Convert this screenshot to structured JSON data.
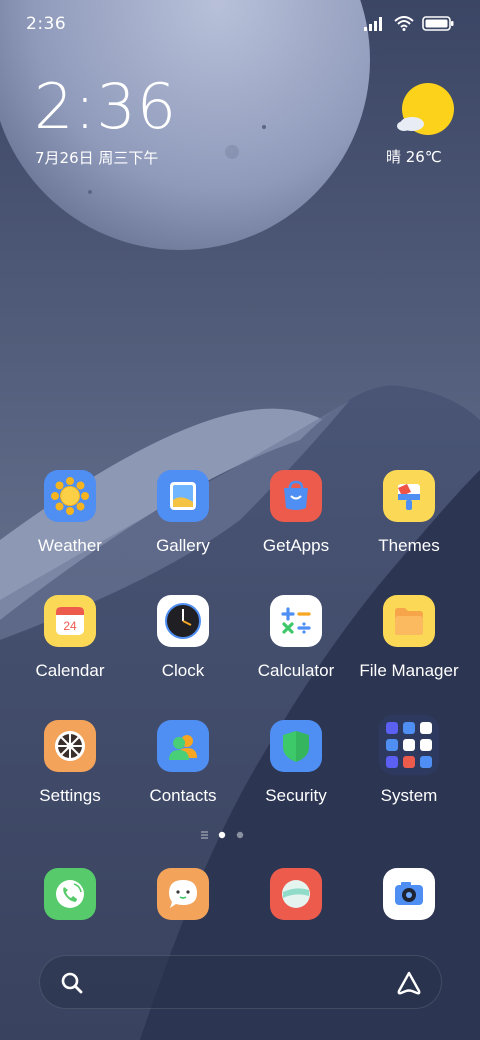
{
  "status_bar": {
    "time": "2:36"
  },
  "widget": {
    "time": "2:36",
    "date": "7月26日 周三下午",
    "weather": "晴 26℃"
  },
  "apps": [
    {
      "label": "Weather",
      "icon": "weather-icon"
    },
    {
      "label": "Gallery",
      "icon": "gallery-icon"
    },
    {
      "label": "GetApps",
      "icon": "getapps-icon"
    },
    {
      "label": "Themes",
      "icon": "themes-icon"
    },
    {
      "label": "Calendar",
      "icon": "calendar-icon",
      "day": "24"
    },
    {
      "label": "Clock",
      "icon": "clock-icon"
    },
    {
      "label": "Calculator",
      "icon": "calculator-icon"
    },
    {
      "label": "File Manager",
      "icon": "file-manager-icon"
    },
    {
      "label": "Settings",
      "icon": "settings-icon"
    },
    {
      "label": "Contacts",
      "icon": "contacts-icon"
    },
    {
      "label": "Security",
      "icon": "security-icon"
    },
    {
      "label": "System",
      "icon": "system-folder-icon"
    }
  ],
  "page_indicator": {
    "pages": 2,
    "current": 1
  },
  "dock": [
    {
      "icon": "phone-icon"
    },
    {
      "icon": "messaging-icon"
    },
    {
      "icon": "browser-icon"
    },
    {
      "icon": "camera-icon"
    }
  ],
  "search": {
    "placeholder": ""
  },
  "colors": {
    "wallpaper_dark": "#2f3957",
    "wallpaper_light": "#9aa5c2",
    "sun": "#fcd31a"
  }
}
